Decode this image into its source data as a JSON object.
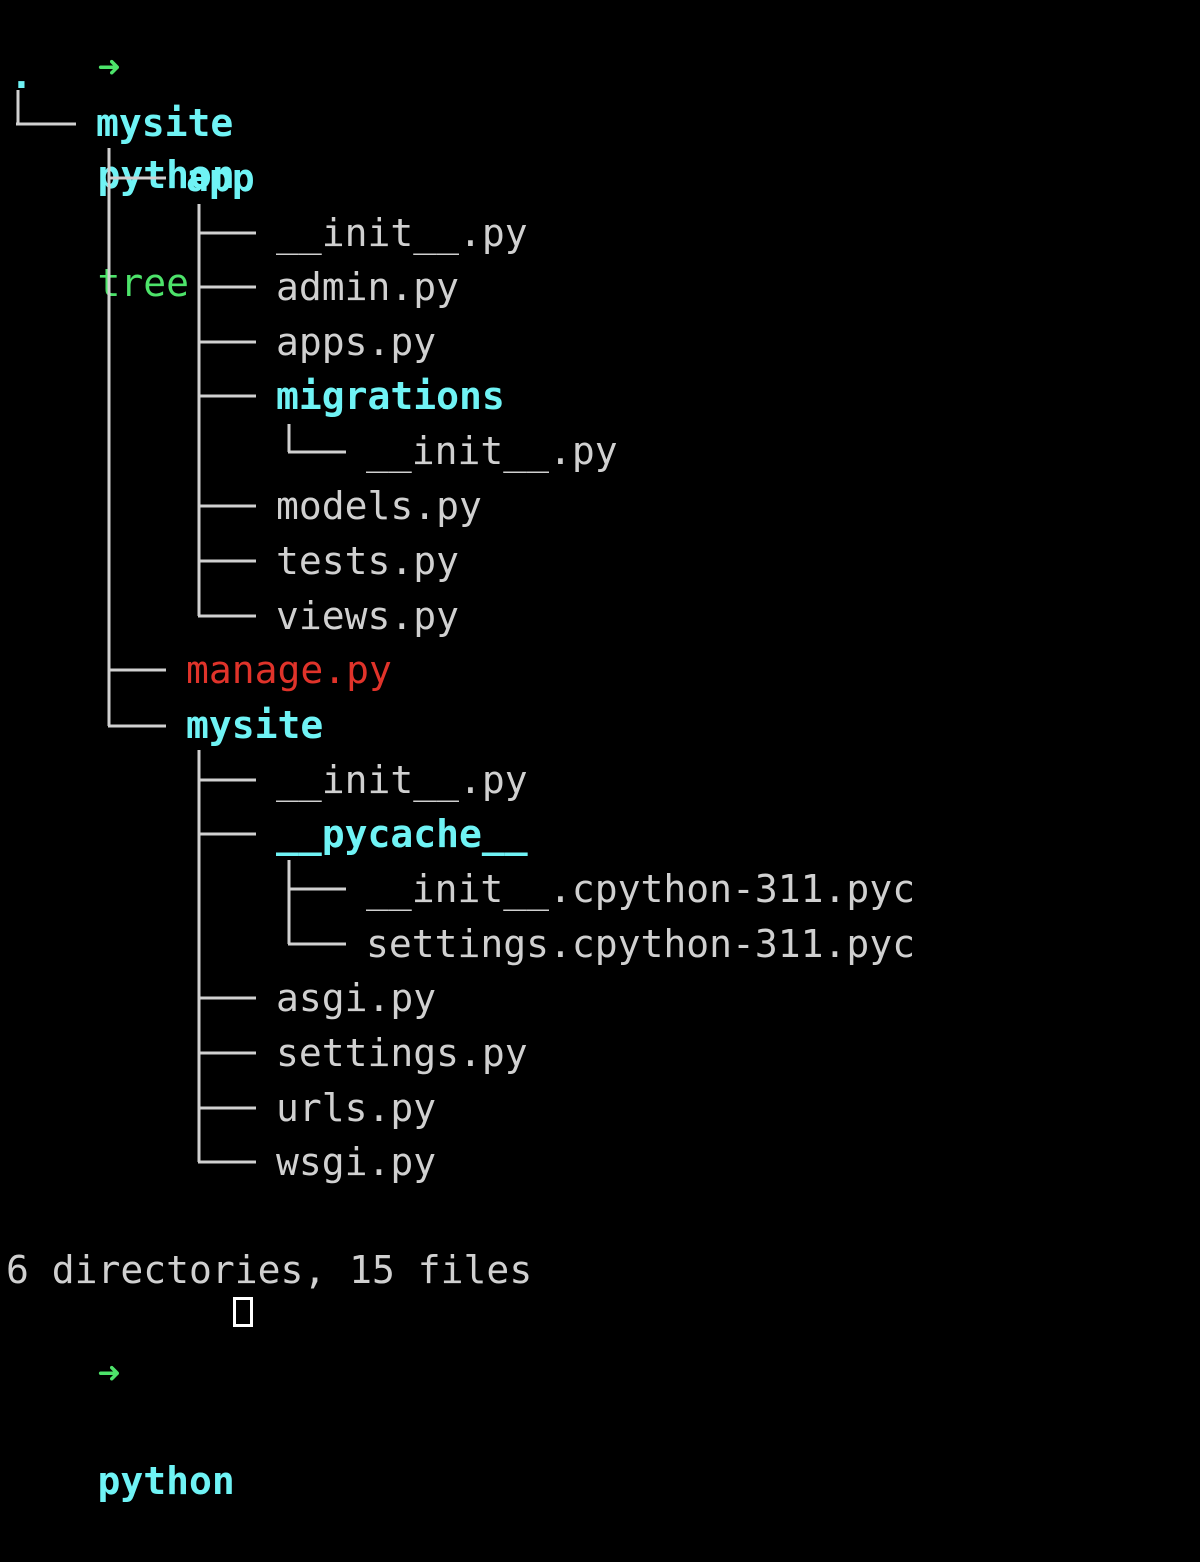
{
  "prompt": {
    "arrow": "➜",
    "cwd": "python",
    "command": "tree"
  },
  "tree": {
    "root": ".",
    "entries": [
      {
        "name": "mysite",
        "kind": "dir"
      },
      {
        "name": "app",
        "kind": "dir"
      },
      {
        "name": "__init__.py",
        "kind": "file"
      },
      {
        "name": "admin.py",
        "kind": "file"
      },
      {
        "name": "apps.py",
        "kind": "file"
      },
      {
        "name": "migrations",
        "kind": "dir"
      },
      {
        "name": "__init__.py",
        "kind": "file"
      },
      {
        "name": "models.py",
        "kind": "file"
      },
      {
        "name": "tests.py",
        "kind": "file"
      },
      {
        "name": "views.py",
        "kind": "file"
      },
      {
        "name": "manage.py",
        "kind": "executable"
      },
      {
        "name": "mysite",
        "kind": "dir"
      },
      {
        "name": "__init__.py",
        "kind": "file"
      },
      {
        "name": "__pycache__",
        "kind": "dir"
      },
      {
        "name": "__init__.cpython-311.pyc",
        "kind": "file"
      },
      {
        "name": "settings.cpython-311.pyc",
        "kind": "file"
      },
      {
        "name": "asgi.py",
        "kind": "file"
      },
      {
        "name": "settings.py",
        "kind": "file"
      },
      {
        "name": "urls.py",
        "kind": "file"
      },
      {
        "name": "wsgi.py",
        "kind": "file"
      }
    ]
  },
  "summary": "6 directories, 15 files",
  "colors": {
    "background": "#000000",
    "directory": "#6ff3f5",
    "file": "#d0d0d0",
    "executable": "#e0332a",
    "prompt": "#4de36a"
  }
}
